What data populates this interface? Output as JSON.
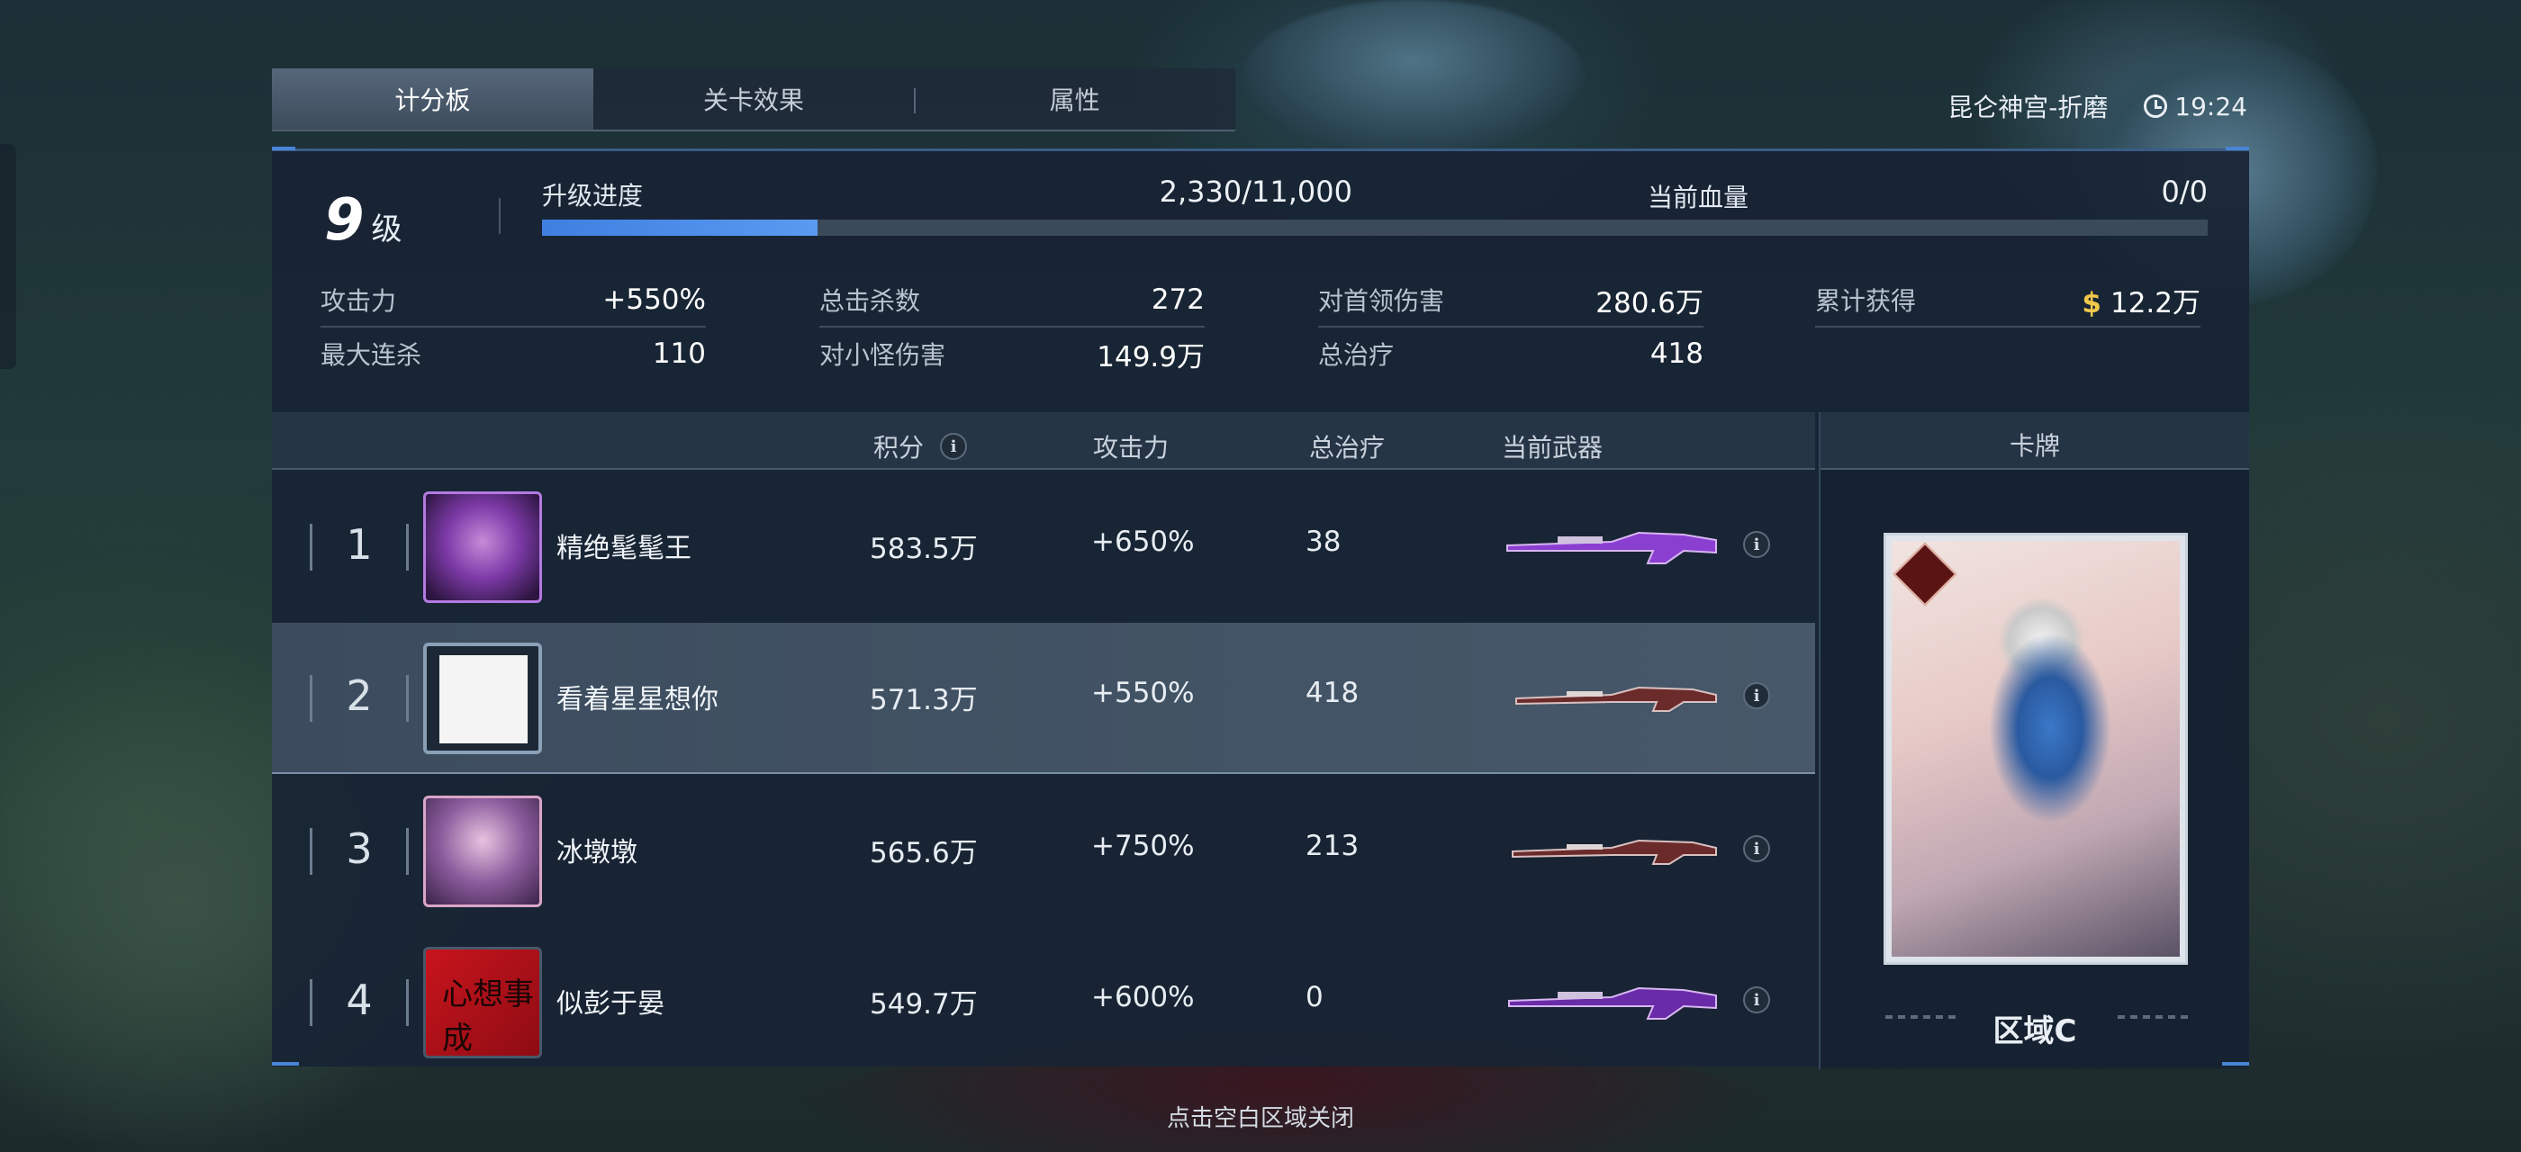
{
  "tabs": [
    {
      "label": "计分板",
      "active": true
    },
    {
      "label": "关卡效果",
      "active": false
    },
    {
      "label": "属性",
      "active": false
    }
  ],
  "header": {
    "location": "昆仑神宫-折磨",
    "time": "19:24"
  },
  "level": {
    "value": "9",
    "unit": "级"
  },
  "xp": {
    "label": "升级进度",
    "text": "2,330/11,000",
    "current": 2330,
    "max": 11000
  },
  "hp": {
    "label": "当前血量",
    "text": "0/0"
  },
  "stats": {
    "attack": {
      "label": "攻击力",
      "value": "+550%"
    },
    "max_streak": {
      "label": "最大连杀",
      "value": "110"
    },
    "total_kills": {
      "label": "总击杀数",
      "value": "272"
    },
    "minion_damage": {
      "label": "对小怪伤害",
      "value": "149.9万"
    },
    "boss_damage": {
      "label": "对首领伤害",
      "value": "280.6万"
    },
    "total_heal": {
      "label": "总治疗",
      "value": "418"
    },
    "earned": {
      "label": "累计获得",
      "value": "12.2万",
      "icon": "dollar-icon",
      "icon_color": "#f2c84b"
    }
  },
  "table": {
    "columns": {
      "score": "积分",
      "attack": "攻击力",
      "heal": "总治疗",
      "weapon": "当前武器"
    },
    "rows": [
      {
        "rank": "1",
        "name": "精绝髦髦王",
        "score": "583.5万",
        "attack": "+650%",
        "heal": "38",
        "weapon_color": "#9a3fe0",
        "highlight": false
      },
      {
        "rank": "2",
        "name": "看着星星想你",
        "score": "571.3万",
        "attack": "+550%",
        "heal": "418",
        "weapon_color": "#b04040",
        "highlight": true
      },
      {
        "rank": "3",
        "name": "冰墩墩",
        "score": "565.6万",
        "attack": "+750%",
        "heal": "213",
        "weapon_color": "#b04040",
        "highlight": false
      },
      {
        "rank": "4",
        "name": "似彭于晏",
        "score": "549.7万",
        "attack": "+600%",
        "heal": "0",
        "weapon_color": "#9a3fe0",
        "highlight": false
      }
    ]
  },
  "card": {
    "header": "卡牌",
    "name": "区域C"
  },
  "avatar4_text": "心想事成",
  "footer": {
    "close_hint": "点击空白区域关闭"
  },
  "colors": {
    "accent": "#4a84d6",
    "xp_fill": "#3f7fe0",
    "highlight_row": "#465869"
  }
}
